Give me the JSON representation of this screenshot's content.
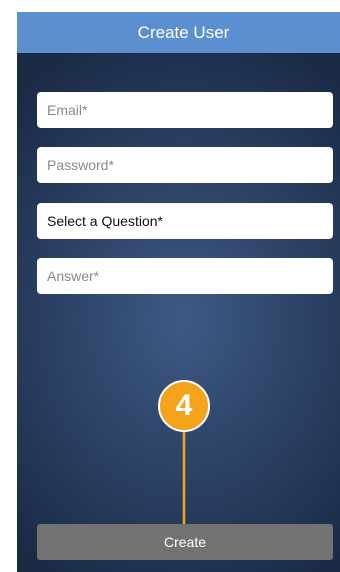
{
  "header": {
    "title": "Create User"
  },
  "form": {
    "email_placeholder": "Email*",
    "password_placeholder": "Password*",
    "question_value": "Select a Question*",
    "answer_placeholder": "Answer*"
  },
  "callout": {
    "step_number": "4"
  },
  "actions": {
    "create_label": "Create"
  },
  "colors": {
    "header": "#5b8fd0",
    "background_dark": "#1a2a45",
    "callout": "#f5a31c",
    "button": "#727272"
  }
}
